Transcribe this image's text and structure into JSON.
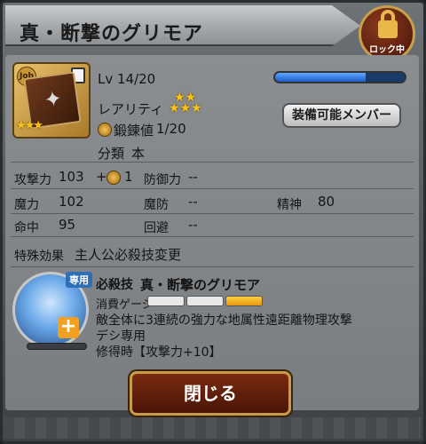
{
  "title": "真・断撃のグリモア",
  "lock": {
    "label": "ロック中"
  },
  "item": {
    "job_label": "Job",
    "rarity_stars": "★★★"
  },
  "level": {
    "label": "Lv 14/20",
    "progress": 0.7
  },
  "rarity": {
    "label": "レアリティ",
    "stars_top": "★★",
    "stars_bottom": "★★★"
  },
  "forging": {
    "label": "鍛錬値",
    "value": "1/20"
  },
  "category": {
    "label": "分類",
    "value": "本"
  },
  "equip_button": "装備可能メンバー",
  "stats": {
    "atk_label": "攻撃力",
    "atk_value": "103",
    "atk_bonus": "+",
    "atk_bonus_value": "1",
    "def_label": "防御力",
    "def_value": "--",
    "mag_label": "魔力",
    "mag_value": "102",
    "mdef_label": "魔防",
    "mdef_value": "--",
    "spirit_label": "精神",
    "spirit_value": "80",
    "acc_label": "命中",
    "acc_value": "95",
    "eva_label": "回避",
    "eva_value": "--"
  },
  "special": {
    "label": "特殊効果",
    "value": "主人公必殺技変更"
  },
  "skill": {
    "exclusive_badge": "専用",
    "type_label": "必殺技",
    "name": "真・断撃のグリモア",
    "gauge_label": "消費ゲージ",
    "gauge_total": 3,
    "gauge_filled": 1,
    "description": "敵全体に3連続の強力な地属性遠距離物理攻撃",
    "owner": "デシ専用",
    "mastery": "修得時【攻撃力+10】"
  },
  "close_button": "閉じる"
}
